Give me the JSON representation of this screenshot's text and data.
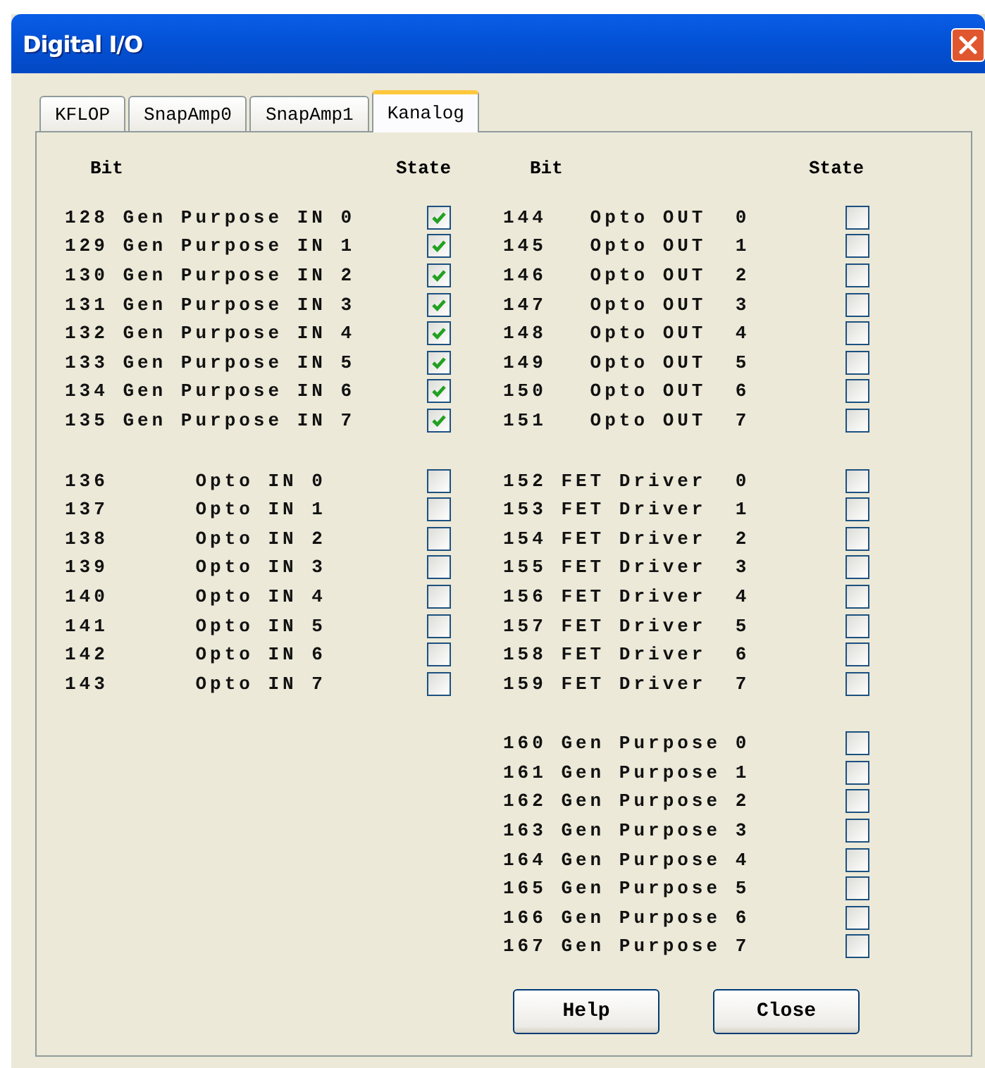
{
  "window": {
    "title": "Digital I/O"
  },
  "tabs": [
    {
      "label": "KFLOP",
      "selected": false
    },
    {
      "label": "SnapAmp0",
      "selected": false
    },
    {
      "label": "SnapAmp1",
      "selected": false
    },
    {
      "label": "Kanalog",
      "selected": true
    }
  ],
  "columns": [
    {
      "bit_header": "Bit",
      "state_header": "State",
      "groups": [
        [
          {
            "label": "128 Gen Purpose IN 0",
            "checked": true
          },
          {
            "label": "129 Gen Purpose IN 1",
            "checked": true
          },
          {
            "label": "130 Gen Purpose IN 2",
            "checked": true
          },
          {
            "label": "131 Gen Purpose IN 3",
            "checked": true
          },
          {
            "label": "132 Gen Purpose IN 4",
            "checked": true
          },
          {
            "label": "133 Gen Purpose IN 5",
            "checked": true
          },
          {
            "label": "134 Gen Purpose IN 6",
            "checked": true
          },
          {
            "label": "135 Gen Purpose IN 7",
            "checked": true
          }
        ],
        [
          {
            "label": "136      Opto IN 0",
            "checked": false
          },
          {
            "label": "137      Opto IN 1",
            "checked": false
          },
          {
            "label": "138      Opto IN 2",
            "checked": false
          },
          {
            "label": "139      Opto IN 3",
            "checked": false
          },
          {
            "label": "140      Opto IN 4",
            "checked": false
          },
          {
            "label": "141      Opto IN 5",
            "checked": false
          },
          {
            "label": "142      Opto IN 6",
            "checked": false
          },
          {
            "label": "143      Opto IN 7",
            "checked": false
          }
        ]
      ]
    },
    {
      "bit_header": "Bit",
      "state_header": "State",
      "groups": [
        [
          {
            "label": "144   Opto OUT  0",
            "checked": false
          },
          {
            "label": "145   Opto OUT  1",
            "checked": false
          },
          {
            "label": "146   Opto OUT  2",
            "checked": false
          },
          {
            "label": "147   Opto OUT  3",
            "checked": false
          },
          {
            "label": "148   Opto OUT  4",
            "checked": false
          },
          {
            "label": "149   Opto OUT  5",
            "checked": false
          },
          {
            "label": "150   Opto OUT  6",
            "checked": false
          },
          {
            "label": "151   Opto OUT  7",
            "checked": false
          }
        ],
        [
          {
            "label": "152 FET Driver  0",
            "checked": false
          },
          {
            "label": "153 FET Driver  1",
            "checked": false
          },
          {
            "label": "154 FET Driver  2",
            "checked": false
          },
          {
            "label": "155 FET Driver  3",
            "checked": false
          },
          {
            "label": "156 FET Driver  4",
            "checked": false
          },
          {
            "label": "157 FET Driver  5",
            "checked": false
          },
          {
            "label": "158 FET Driver  6",
            "checked": false
          },
          {
            "label": "159 FET Driver  7",
            "checked": false
          }
        ],
        [
          {
            "label": "160 Gen Purpose 0",
            "checked": false
          },
          {
            "label": "161 Gen Purpose 1",
            "checked": false
          },
          {
            "label": "162 Gen Purpose 2",
            "checked": false
          },
          {
            "label": "163 Gen Purpose 3",
            "checked": false
          },
          {
            "label": "164 Gen Purpose 4",
            "checked": false
          },
          {
            "label": "165 Gen Purpose 5",
            "checked": false
          },
          {
            "label": "166 Gen Purpose 6",
            "checked": false
          },
          {
            "label": "167 Gen Purpose 7",
            "checked": false
          }
        ]
      ]
    }
  ],
  "buttons": [
    "Help",
    "Close"
  ]
}
